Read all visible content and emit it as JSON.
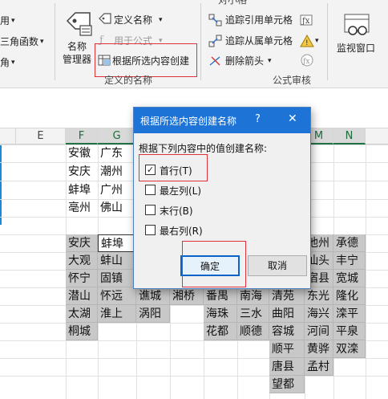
{
  "ribbon": {
    "define_group": {
      "name_manager_label_1": "名称",
      "name_manager_label_2": "管理器",
      "define_name": "定义名称",
      "use_in_formula": "用于公式",
      "create_from_selection": "根据所选内容创建",
      "group_label": "定义的名称"
    },
    "audit_group": {
      "trace_precedents": "追踪引用单元格",
      "trace_dependents": "追踪从属单元格",
      "remove_arrows": "删除箭头",
      "group_label": "公式审核",
      "watch_window": "监视窗口"
    },
    "left_fragments": {
      "row1": "用",
      "row2": "三角函数",
      "row3": "角"
    },
    "top_clip": "对小格"
  },
  "sheet": {
    "columns": [
      "E",
      "F",
      "G",
      "M",
      "N"
    ],
    "cells": {
      "F1": "安徽",
      "G1": "广东",
      "F2": "安庆",
      "G2": "潮州",
      "F3": "蚌埠",
      "G3": "广州",
      "F4": "亳州",
      "G4": "佛山",
      "F6": "安庆",
      "G6": "蚌埠",
      "M6": "池州",
      "N6": "承德",
      "F7": "大观",
      "G7": "蚌山",
      "M7": "汕头",
      "N7": "丰宁",
      "F8": "怀宁",
      "G8": "固镇",
      "M8": "宿县",
      "N8": "宽城",
      "F9": "潜山",
      "G9": "怀远",
      "H9": "谯城",
      "I9": "湘桥",
      "J9": "番禺",
      "K9": "南海",
      "L9": "清苑",
      "M9": "东光",
      "N9": "隆化",
      "F10": "太湖",
      "G10": "淮上",
      "H10": "涡阳",
      "J10": "海珠",
      "K10": "三水",
      "L10": "曲阳",
      "M10": "海兴",
      "N10": "滦平",
      "F11": "桐城",
      "J11": "花都",
      "K11": "顺德",
      "L11": "容城",
      "M11": "河间",
      "N11": "平泉",
      "L12": "顺平",
      "M12": "黄骅",
      "N12": "双滦",
      "L13": "唐县",
      "M13": "孟村",
      "L14": "望都"
    }
  },
  "dialog": {
    "title": "根据所选内容创建名称",
    "help": "?",
    "close": "✕",
    "prompt": "根据下列内容中的值创建名称:",
    "options": [
      {
        "label": "首行(T)",
        "checked": true
      },
      {
        "label": "最左列(L)",
        "checked": false
      },
      {
        "label": "末行(B)",
        "checked": false
      },
      {
        "label": "最右列(R)",
        "checked": false
      }
    ],
    "ok": "确定",
    "cancel": "取消"
  },
  "colors": {
    "title_bar": "#1e73d6",
    "highlight_box": "#e0303a",
    "selected_cells": "#c8c8c8"
  }
}
